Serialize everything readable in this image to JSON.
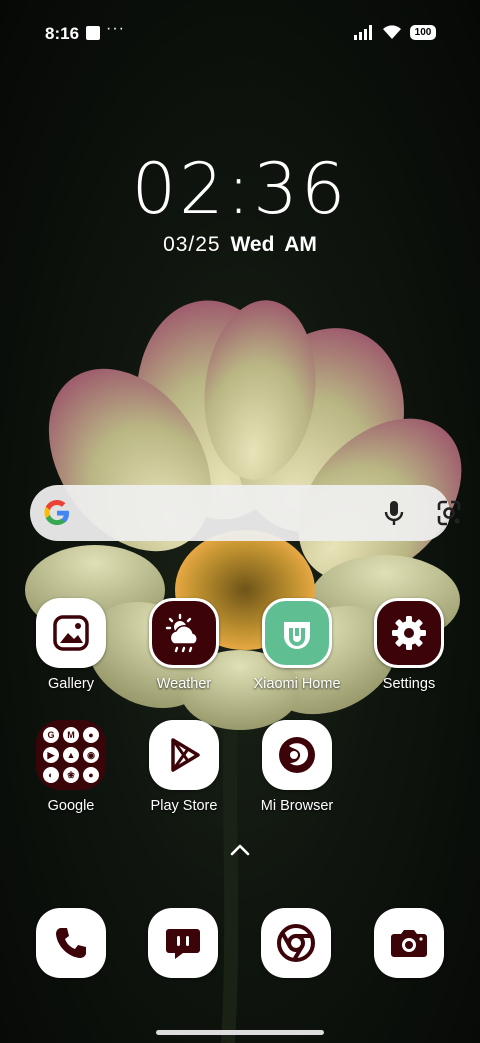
{
  "status_bar": {
    "time": "8:16",
    "overflow": "···",
    "battery": "100",
    "icons": [
      "square-notification-icon",
      "signal-icon",
      "wifi-icon",
      "battery-icon"
    ]
  },
  "lock_clock": {
    "time": "02:36",
    "date": "03/25",
    "weekday": "Wed",
    "ampm": "AM"
  },
  "search_widget": {
    "icons": [
      "google-logo-icon",
      "microphone-icon",
      "google-lens-icon"
    ]
  },
  "apps": [
    {
      "label": "Gallery",
      "icon": "gallery-icon"
    },
    {
      "label": "Weather",
      "icon": "weather-icon"
    },
    {
      "label": "Xiaomi Home",
      "icon": "xiaomi-home-icon"
    },
    {
      "label": "Settings",
      "icon": "gear-icon"
    },
    {
      "label": "Google",
      "icon": "google-folder-icon"
    },
    {
      "label": "Play Store",
      "icon": "play-store-icon"
    },
    {
      "label": "Mi Browser",
      "icon": "mi-browser-icon"
    }
  ],
  "google_folder": [
    "G",
    "M",
    "●",
    "▶",
    "▲",
    "◉",
    "◐",
    "❀",
    "●"
  ],
  "dock": [
    {
      "icon": "phone-icon"
    },
    {
      "icon": "messages-icon"
    },
    {
      "icon": "chrome-icon"
    },
    {
      "icon": "camera-icon"
    }
  ],
  "colors": {
    "icon_accent": "#3c0309",
    "search_bg": "#eeeeee",
    "xiaomi_green": "#5fbf92"
  }
}
